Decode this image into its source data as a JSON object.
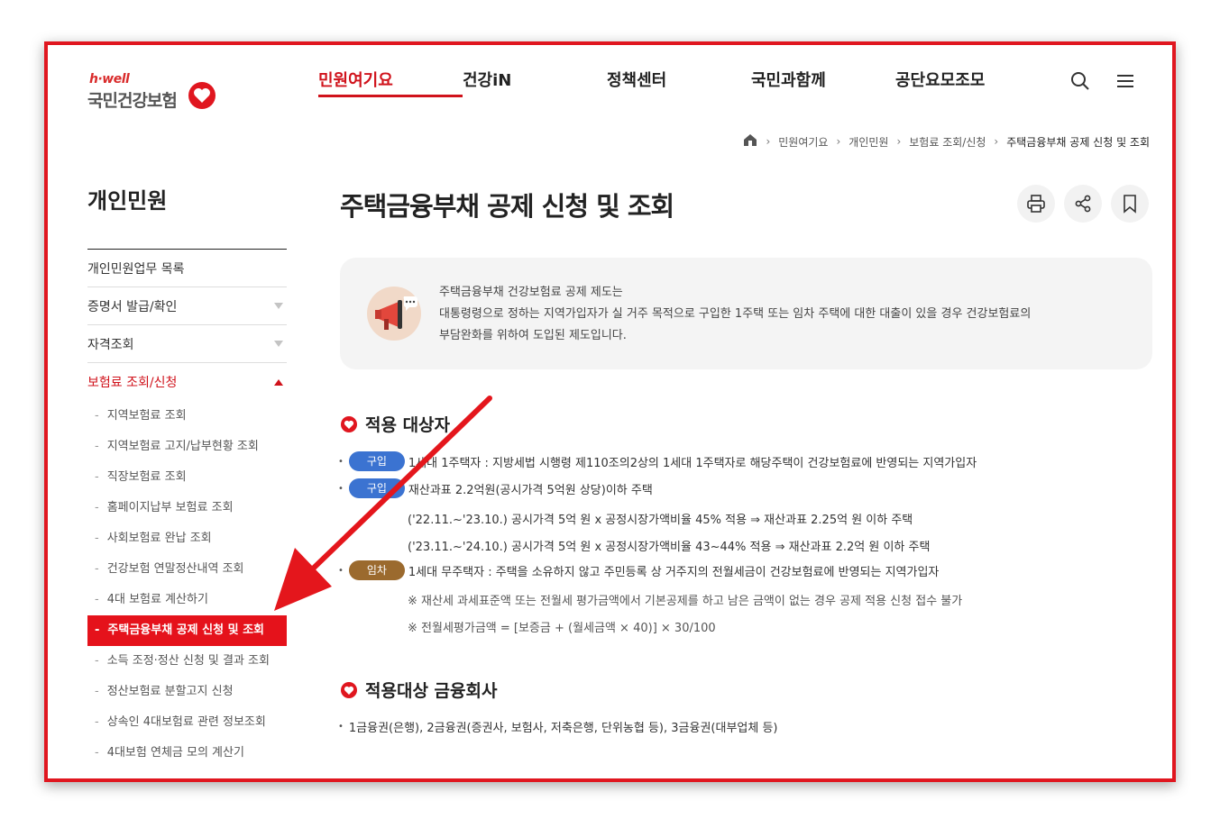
{
  "header": {
    "logo_top": "h·well",
    "logo_name": "국민건강보험",
    "nav": [
      "민원여기요",
      "건강iN",
      "정책센터",
      "국민과함께",
      "공단요모조모"
    ],
    "icons": [
      "search-icon",
      "menu-icon"
    ]
  },
  "breadcrumb": [
    "민원여기요",
    "개인민원",
    "보험료 조회/신청",
    "주택금융부채 공제 신청 및 조회"
  ],
  "sidebar": {
    "title": "개인민원",
    "items": [
      {
        "label": "개인민원업무 목록"
      },
      {
        "label": "증명서 발급/확인"
      },
      {
        "label": "자격조회"
      },
      {
        "label": "보험료 조회/신청"
      }
    ],
    "sub_items": [
      "지역보험료 조회",
      "지역보험료 고지/납부현황 조회",
      "직장보험료 조회",
      "홈페이지납부 보험료 조회",
      "사회보험료 완납 조회",
      "건강보험 연말정산내역 조회",
      "4대 보험료 계산하기",
      "주택금융부채 공제 신청 및 조회",
      "소득 조정·정산 신청 및 결과 조회",
      "정산보험료 분할고지 신청",
      "상속인 4대보험료 관련 정보조회",
      "4대보험 연체금 모의 계산기"
    ]
  },
  "main": {
    "title": "주택금융부채 공제 신청 및 조회",
    "tool_icons": [
      "print-icon",
      "share-icon",
      "bookmark-icon"
    ],
    "intro": [
      "주택금융부채 건강보험료 공제 제도는",
      "대통령령으로 정하는 지역가입자가 실 거주 목적으로 구입한 1주택 또는 임차 주택에 대한 대출이 있을 경우 건강보험료의",
      "부담완화를 위하여 도입된 제도입니다."
    ],
    "section1": {
      "title": "적용 대상자",
      "rows": [
        {
          "badge": "구입",
          "text": "1세대 1주택자 : 지방세법 시행령 제110조의2상의 1세대 1주택자로 해당주택이 건강보험료에 반영되는 지역가입자"
        },
        {
          "badge": "구입",
          "text": "재산과표 2.2억원(공시가격 5억원 상당)이하 주택"
        },
        {
          "badge": "임차",
          "text": "1세대 무주택자 : 주택을 소유하지 않고 주민등록 상 거주지의 전월세금이 건강보험료에 반영되는 지역가입자"
        }
      ],
      "sub_lines": [
        "('22.11.~'23.10.) 공시가격 5억 원 x 공정시장가액비율 45% 적용 ⇒ 재산과표 2.25억 원 이하 주택",
        "('23.11.~'24.10.) 공시가격 5억 원 x 공정시장가액비율 43~44% 적용 ⇒ 재산과표 2.2억 원 이하 주택"
      ],
      "notes": [
        "※ 재산세 과세표준액 또는 전월세 평가금액에서 기본공제를 하고 남은 금액이 없는 경우 공제 적용 신청 접수 불가",
        "※ 전월세평가금액 = [보증금 + (월세금액 × 40)] × 30/100"
      ]
    },
    "section2": {
      "title": "적용대상 금융회사",
      "text": "1금융권(은행), 2금융권(증권사, 보험사, 저축은행, 단위농협 등), 3금융권(대부업체 등)"
    }
  },
  "colors": {
    "accent": "#e0161f",
    "active_menu": "#e5121b",
    "badge_buy": "#3b73d1",
    "badge_rent": "#9b6a2e"
  }
}
